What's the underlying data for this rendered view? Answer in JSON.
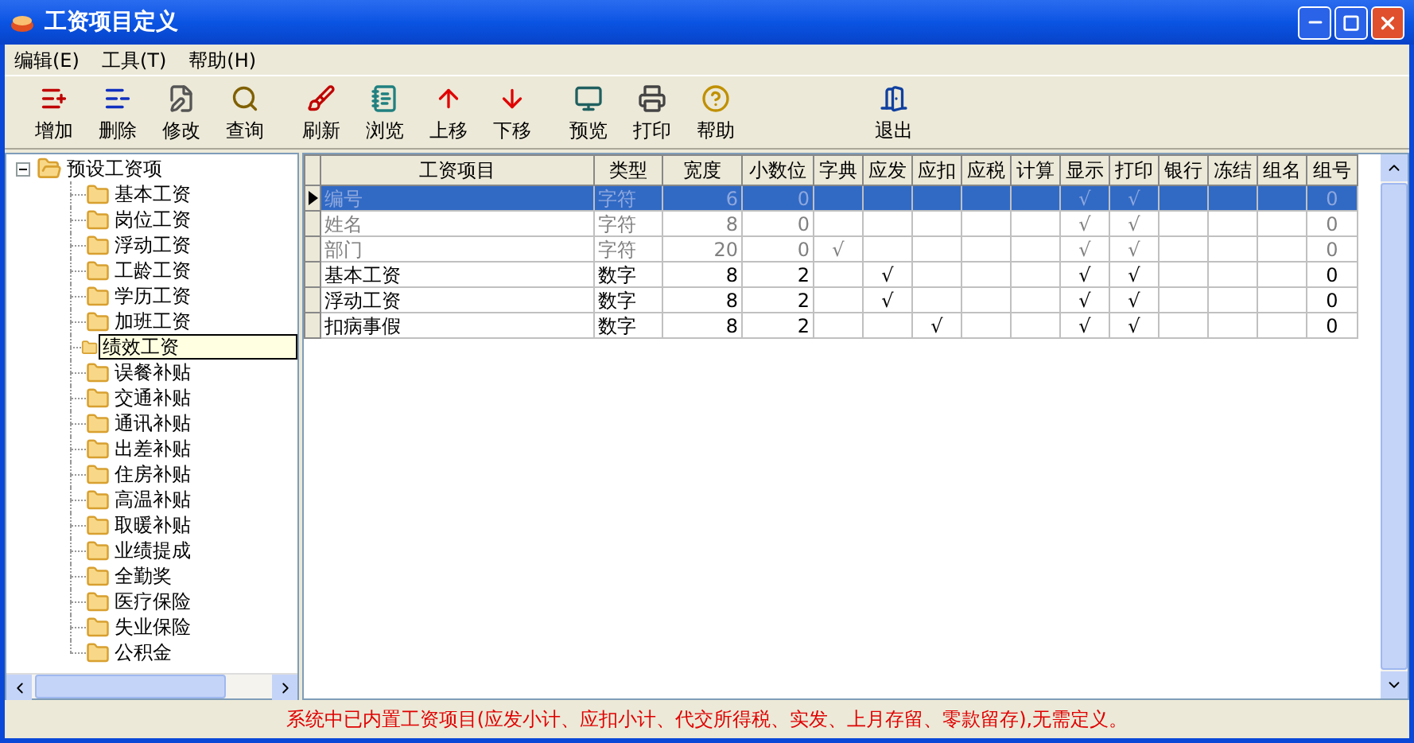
{
  "window": {
    "title": "工资项目定义"
  },
  "menu": [
    "编辑(E)",
    "工具(T)",
    "帮助(H)"
  ],
  "toolbar": [
    [
      {
        "label": "增加",
        "kind": "add"
      },
      {
        "label": "删除",
        "kind": "remove"
      },
      {
        "label": "修改",
        "kind": "edit"
      },
      {
        "label": "查询",
        "kind": "query"
      }
    ],
    [
      {
        "label": "刷新",
        "kind": "refresh"
      },
      {
        "label": "浏览",
        "kind": "browse"
      },
      {
        "label": "上移",
        "kind": "up"
      },
      {
        "label": "下移",
        "kind": "down"
      }
    ],
    [
      {
        "label": "预览",
        "kind": "preview"
      },
      {
        "label": "打印",
        "kind": "print"
      },
      {
        "label": "帮助",
        "kind": "help"
      }
    ],
    [
      {
        "label": "退出",
        "kind": "exit"
      }
    ]
  ],
  "tree": {
    "label": "预设工资项",
    "expanded": true,
    "children": [
      {
        "label": "基本工资",
        "hovered": false
      },
      {
        "label": "岗位工资",
        "hovered": false
      },
      {
        "label": "浮动工资",
        "hovered": false
      },
      {
        "label": "工龄工资",
        "hovered": false
      },
      {
        "label": "学历工资",
        "hovered": false
      },
      {
        "label": "加班工资",
        "hovered": false
      },
      {
        "label": "绩效工资",
        "hovered": true
      },
      {
        "label": "误餐补贴",
        "hovered": false
      },
      {
        "label": "交通补贴",
        "hovered": false
      },
      {
        "label": "通讯补贴",
        "hovered": false
      },
      {
        "label": "出差补贴",
        "hovered": false
      },
      {
        "label": "住房补贴",
        "hovered": false
      },
      {
        "label": "高温补贴",
        "hovered": false
      },
      {
        "label": "取暖补贴",
        "hovered": false
      },
      {
        "label": "业绩提成",
        "hovered": false
      },
      {
        "label": "全勤奖",
        "hovered": false
      },
      {
        "label": "医疗保险",
        "hovered": false
      },
      {
        "label": "失业保险",
        "hovered": false
      },
      {
        "label": "公积金",
        "hovered": false
      }
    ]
  },
  "table": {
    "columns": [
      "工资项目",
      "类型",
      "宽度",
      "小数位",
      "字典",
      "应发",
      "应扣",
      "应税",
      "计算",
      "显示",
      "打印",
      "银行",
      "冻结",
      "组名",
      "组号"
    ],
    "rows": [
      {
        "selected": true,
        "system": true,
        "cells": [
          "编号",
          "字符",
          "6",
          "0",
          null,
          null,
          null,
          null,
          null,
          "√",
          "√",
          null,
          null,
          null,
          "0"
        ]
      },
      {
        "selected": false,
        "system": true,
        "cells": [
          "姓名",
          "字符",
          "8",
          "0",
          null,
          null,
          null,
          null,
          null,
          "√",
          "√",
          null,
          null,
          null,
          "0"
        ]
      },
      {
        "selected": false,
        "system": true,
        "cells": [
          "部门",
          "字符",
          "20",
          "0",
          "√",
          null,
          null,
          null,
          null,
          "√",
          "√",
          null,
          null,
          null,
          "0"
        ]
      },
      {
        "selected": false,
        "system": false,
        "cells": [
          "基本工资",
          "数字",
          "8",
          "2",
          null,
          "√",
          null,
          null,
          null,
          "√",
          "√",
          null,
          null,
          null,
          "0"
        ]
      },
      {
        "selected": false,
        "system": false,
        "cells": [
          "浮动工资",
          "数字",
          "8",
          "2",
          null,
          "√",
          null,
          null,
          null,
          "√",
          "√",
          null,
          null,
          null,
          "0"
        ]
      },
      {
        "selected": false,
        "system": false,
        "cells": [
          "扣病事假",
          "数字",
          "8",
          "2",
          null,
          null,
          "√",
          null,
          null,
          "√",
          "√",
          null,
          null,
          null,
          "0"
        ]
      }
    ]
  },
  "status_bar": "系统中已内置工资项目(应发小计、应扣小计、代交所得税、实发、上月存留、零款留存),无需定义。"
}
